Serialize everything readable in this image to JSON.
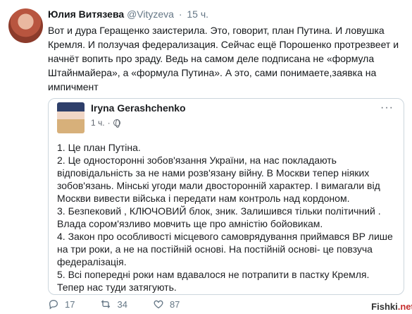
{
  "tweet": {
    "author_name": "Юлия Витязева",
    "handle": "@Vityzeva",
    "separator": "·",
    "time": "15 ч.",
    "text": "Вот и дура Геращенко заистерила. Это, говорит, план Путина. И ловушка Кремля. И ползучая федерализация. Сейчас ещё Порошенко протрезвеет и начнёт вопить про зраду. Ведь на самом деле подписана не «формула Штайнмайера», а «формула Путина». А это, сами понимаете,заявка на импичмент"
  },
  "embedded_post": {
    "author": "Iryna Gerashchenko",
    "time": "1 ч.",
    "more_label": "···",
    "lines": [
      "1.  Це план Путіна.",
      "2. Це односторонні зобов'язання України, на нас покладають відповідальність за не нами розв'язану війну.  В Москви тепер ніяких зобов'язань. Мінські угоди мали двосторонній характер. І вимагали від Москви вивести війська і передати нам контроль над кордоном.",
      "3. Безпековий , КЛЮЧОВИЙ блок, зник. Залишився тільки політичний . Влада сором'язливо мовчить ще про амністію бойовикам.",
      "4. Закон про особливості місцевого самоврядування приймався ВР лише    на три роки, а не на постійній основі. На постійній основі- це повзуча федералізація.",
      "5. Всі попередні роки нам вдавалося не потрапити в пастку Кремля. Тепер нас туди затягують."
    ]
  },
  "actions": {
    "reply_count": "17",
    "retweet_count": "34",
    "like_count": "87"
  },
  "watermark": {
    "prefix": "Fishki",
    "suffix": ".net"
  }
}
